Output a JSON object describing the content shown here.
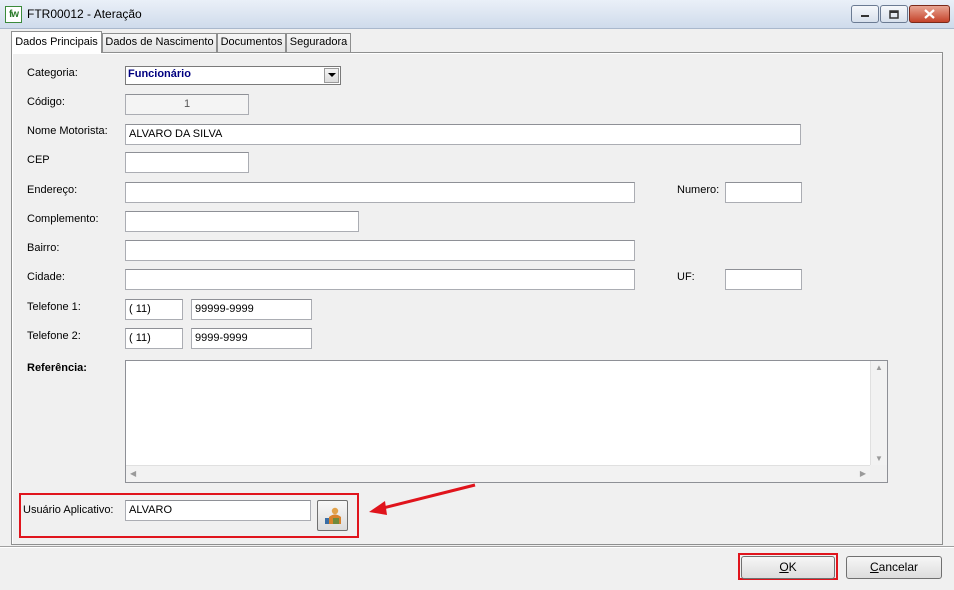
{
  "window": {
    "app_icon_text": "fw",
    "title": "FTR00012 - Ateração"
  },
  "tabs": [
    {
      "label": "Dados Principais",
      "active": true
    },
    {
      "label": "Dados de Nascimento",
      "active": false
    },
    {
      "label": "Documentos",
      "active": false
    },
    {
      "label": "Seguradora",
      "active": false
    }
  ],
  "form": {
    "categoria": {
      "label": "Categoria:",
      "value": "Funcionário"
    },
    "codigo": {
      "label": "Código:",
      "value": "1"
    },
    "nome_motorista": {
      "label": "Nome Motorista:",
      "value": "ALVARO DA SILVA"
    },
    "cep": {
      "label": "CEP",
      "value": ""
    },
    "endereco": {
      "label": "Endereço:",
      "value": ""
    },
    "numero": {
      "label": "Numero:",
      "value": ""
    },
    "complemento": {
      "label": "Complemento:",
      "value": ""
    },
    "bairro": {
      "label": "Bairro:",
      "value": ""
    },
    "cidade": {
      "label": "Cidade:",
      "value": ""
    },
    "uf": {
      "label": "UF:",
      "value": ""
    },
    "telefone1": {
      "label": "Telefone 1:",
      "ddd": "( 11)",
      "numero": "99999-9999"
    },
    "telefone2": {
      "label": "Telefone 2:",
      "ddd": "( 11)",
      "numero": "9999-9999"
    },
    "referencia": {
      "label": "Referência:",
      "value": ""
    },
    "usuario_aplicativo": {
      "label": "Usuário Aplicativo:",
      "value": "ALVARO"
    }
  },
  "buttons": {
    "ok": "OK",
    "cancel": "Cancelar"
  },
  "colors": {
    "highlight": "#e0141c",
    "combo_text": "#000080"
  },
  "icons": [
    "minimize-icon",
    "maximize-icon",
    "close-icon",
    "dropdown-arrow-icon",
    "user-picker-icon",
    "red-arrow-annotation"
  ]
}
